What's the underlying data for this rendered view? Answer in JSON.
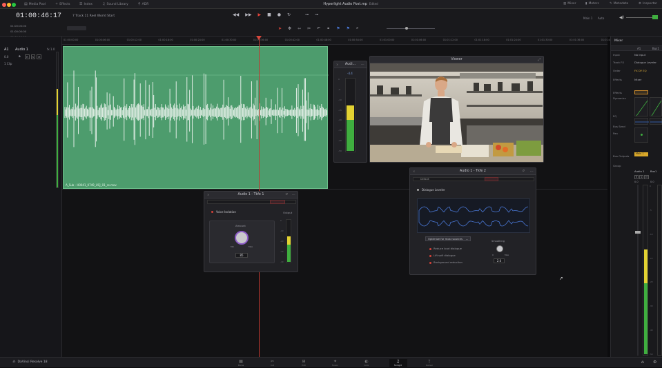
{
  "topbar": {
    "items": [
      {
        "label": "Media Pool",
        "icon": "media-pool-icon"
      },
      {
        "label": "Effects",
        "icon": "effects-icon"
      },
      {
        "label": "Index",
        "icon": "index-icon"
      },
      {
        "label": "Sound Library",
        "icon": "sound-library-icon"
      },
      {
        "label": "ADR",
        "icon": "adr-icon"
      }
    ],
    "project_title": "Hyperlight Audio Post.mp",
    "project_status": "Edited",
    "right_items": [
      {
        "label": "Mixer",
        "icon": "mixer-icon"
      },
      {
        "label": "Meters",
        "icon": "meters-icon"
      },
      {
        "label": "Metadata",
        "icon": "metadata-icon"
      },
      {
        "label": "Inspector",
        "icon": "inspector-icon"
      }
    ]
  },
  "timeline": {
    "timecode": "01:00:46:17",
    "name": "7 Track 11 Reel World Start",
    "timecodes_left": [
      "01:00:00:00",
      "01:00:00:00",
      "00:00:00:00"
    ],
    "track_name": "Audio 1",
    "track_id": "A1",
    "track_fx": "fx 1.0",
    "track_clip_count": "1 Clip",
    "track_level": "0.0",
    "track_buttons": [
      "R",
      "S",
      "M"
    ],
    "ruler_ticks": [
      "01:00:00:00",
      "01:00:06:00",
      "01:00:12:00",
      "01:00:18:00",
      "01:00:24:00",
      "01:00:30:00",
      "01:00:36:00",
      "01:00:42:00",
      "01:00:48:00",
      "01:00:54:00",
      "01:01:00:00",
      "01:01:06:00",
      "01:01:12:00",
      "01:01:18:00",
      "01:01:24:00",
      "01:01:30:00",
      "01:01:36:00",
      "01:01:42:00"
    ],
    "clip_label": "A_Sub - H0041_0749_UCJ_01_ss.mov",
    "transport_icons": [
      "rewind-icon",
      "fast-forward-icon",
      "play-icon",
      "stop-icon",
      "record-icon",
      "loop-icon"
    ],
    "mix_label": "Main 1",
    "auto_label": "Auto"
  },
  "meter_panel": {
    "title": "Audi...",
    "value": "-4.4",
    "level": 0.62,
    "scale": [
      "0",
      "-5",
      "-10",
      "-15",
      "-20",
      "-30",
      "-40",
      "-50"
    ]
  },
  "viewer": {
    "title": "Viewer"
  },
  "voice_isolation": {
    "title": "Audio 1 - Tkfe 1",
    "toggle_label": "Voice Isolation",
    "output_label": "Output",
    "amount_label": "Amount",
    "min_label": "Min",
    "max_label": "Max",
    "value": "85",
    "output_level": 0.6,
    "output_scale": [
      "0",
      "-10",
      "-20",
      "-30",
      "-40"
    ]
  },
  "dialogue_leveler": {
    "title": "Audio 1 - Tkfe 2",
    "preset": "Default",
    "toggle_label": "Dialogue Leveler",
    "dropdown": "Optimize for most sources",
    "options": [
      "Reduce loud dialogue",
      "Lift soft dialogue",
      "Background reduction"
    ],
    "smoothing_label": "Smoothing",
    "smoothing_min": "0",
    "smoothing_max": "Max",
    "value": "2.0"
  },
  "mixer": {
    "title": "Mixer",
    "columns": [
      "A1",
      "Bus1"
    ],
    "rows": [
      {
        "label": "Input",
        "value": "No Input"
      },
      {
        "label": "Track FX",
        "value": "Dialogue Leveler"
      },
      {
        "label": "Order",
        "value": "FX DY EQ"
      },
      {
        "label": "Effects",
        "value": "Mixer"
      },
      {
        "label": "Effects",
        "value": ""
      },
      {
        "label": "Dynamics",
        "value": ""
      },
      {
        "label": "EQ",
        "value": ""
      },
      {
        "label": "Bus Send",
        "value": ""
      },
      {
        "label": "Pan",
        "value": ""
      },
      {
        "label": "Bus Outputs",
        "value": "Main 1"
      },
      {
        "label": "Group",
        "value": ""
      }
    ],
    "channels": [
      "Audio 1",
      "Bus1"
    ],
    "channel_values": [
      "0.0",
      "0.0"
    ],
    "channel_buttons": [
      "R",
      "S",
      "M"
    ],
    "fader_levels": [
      0.62,
      0.0
    ],
    "scale": [
      "0",
      "-5",
      "-10",
      "-15",
      "-20",
      "-30",
      "-40",
      "-50"
    ]
  },
  "bottombar": {
    "app_name": "DaVinci Resolve 18",
    "pages": [
      {
        "name": "Media",
        "icon": "media-page-icon"
      },
      {
        "name": "Cut",
        "icon": "cut-page-icon"
      },
      {
        "name": "Edit",
        "icon": "edit-page-icon"
      },
      {
        "name": "Fusion",
        "icon": "fusion-page-icon"
      },
      {
        "name": "Color",
        "icon": "color-page-icon"
      },
      {
        "name": "Fairlight",
        "icon": "fairlight-page-icon"
      },
      {
        "name": "Deliver",
        "icon": "deliver-page-icon"
      }
    ],
    "active_page": 5
  },
  "colors": {
    "clip_green": "#4d9c6d",
    "playhead_red": "#d8473c",
    "meter_green": "#3fae3f",
    "meter_yellow": "#e3d232",
    "knob_purple": "#8d5cc7",
    "accent_blue": "#4a78d6"
  }
}
